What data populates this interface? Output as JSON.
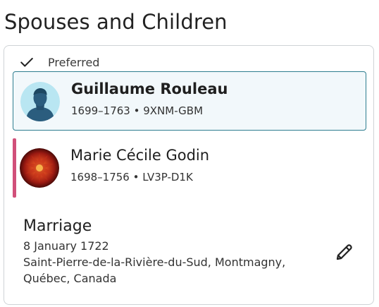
{
  "page": {
    "title": "Spouses and Children"
  },
  "preferred": {
    "label": "Preferred",
    "icon": "check-icon"
  },
  "persons": [
    {
      "name": "Guillaume Rouleau",
      "meta": "1699–1763 • 9XNM-GBM",
      "avatar": "male-silhouette-avatar",
      "preferred": true,
      "accent": "#2e7d8f"
    },
    {
      "name": "Marie Cécile Godin",
      "meta": "1698–1756 • LV3P-D1K",
      "avatar": "red-flower-photo-avatar",
      "accent": "#d1507a"
    }
  ],
  "marriage": {
    "title": "Marriage",
    "date": "8 January 1722",
    "place": "Saint-Pierre-de-la-Rivière-du-Sud, Montmagny, Québec, Canada",
    "edit_icon": "pencil-icon"
  }
}
